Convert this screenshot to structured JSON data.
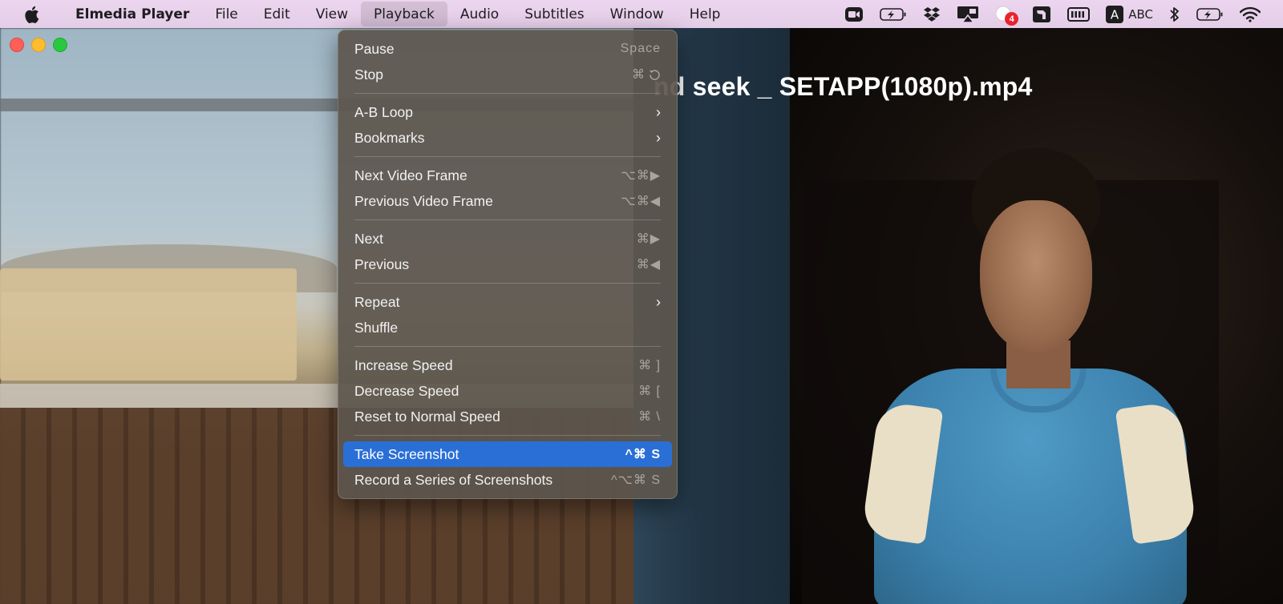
{
  "menubar": {
    "app_name": "Elmedia Player",
    "items": [
      "File",
      "Edit",
      "View",
      "Playback",
      "Audio",
      "Subtitles",
      "Window",
      "Help"
    ],
    "active_item": "Playback",
    "tray": {
      "notification_count": "4",
      "input_source_letter": "A",
      "input_source_label": "ABC"
    }
  },
  "video": {
    "title_visible": "nd seek _ SETAPP(1080p).mp4"
  },
  "playback_menu": {
    "items": [
      {
        "label": "Pause",
        "shortcut": "Space"
      },
      {
        "label": "Stop",
        "shortcut": "⌘"
      },
      {
        "label": "A-B Loop",
        "submenu": "›"
      },
      {
        "label": "Bookmarks",
        "submenu": "›"
      },
      {
        "label": "Next Video Frame",
        "shortcut": "⌥⌘▶"
      },
      {
        "label": "Previous Video Frame",
        "shortcut": "⌥⌘◀"
      },
      {
        "label": "Next",
        "shortcut": "⌘▶"
      },
      {
        "label": "Previous",
        "shortcut": "⌘◀"
      },
      {
        "label": "Repeat",
        "submenu": "›"
      },
      {
        "label": "Shuffle"
      },
      {
        "label": "Increase Speed",
        "shortcut": "⌘ ]"
      },
      {
        "label": "Decrease Speed",
        "shortcut": "⌘ ["
      },
      {
        "label": "Reset to Normal Speed",
        "shortcut": "⌘ \\"
      },
      {
        "label": "Take Screenshot",
        "shortcut": "^⌘ S"
      },
      {
        "label": "Record a Series of Screenshots",
        "shortcut": "^⌥⌘ S"
      }
    ],
    "selected_item": "Take Screenshot"
  },
  "colors": {
    "menubar_bg": "#e8d1ea",
    "menu_highlight": "#2a6fd6",
    "traffic_red": "#fe5f57",
    "traffic_yellow": "#febc2e",
    "traffic_green": "#28c840"
  },
  "icons": [
    "apple-icon",
    "zoom-icon",
    "battery-charging-icon",
    "dropbox-icon",
    "airplay-icon",
    "notification-icon",
    "screenshot-app-icon",
    "memory-icon",
    "input-source-icon",
    "bluetooth-icon",
    "wifi-icon",
    "restart-icon",
    "submenu-chevron-icon"
  ]
}
